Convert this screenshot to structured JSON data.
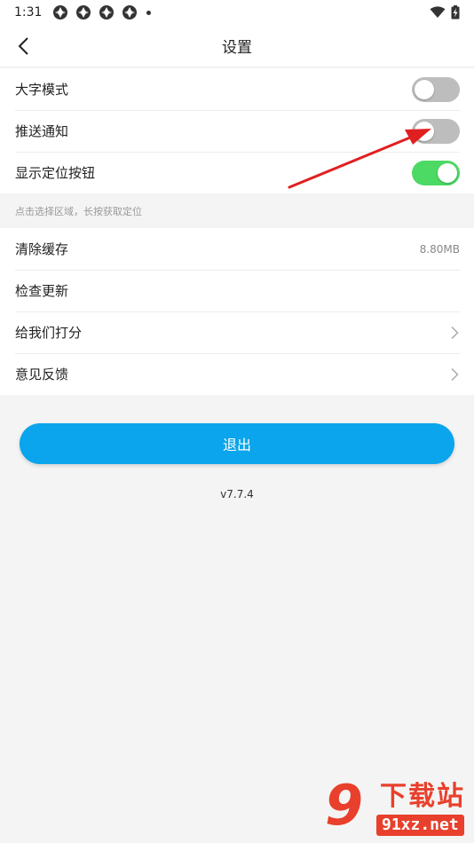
{
  "status_bar": {
    "time": "1:31",
    "notification_icons": [
      "app-notification-icon",
      "app-notification-icon",
      "app-notification-icon",
      "app-notification-icon"
    ],
    "wifi_icon": "wifi-icon",
    "battery_icon": "battery-charging-icon"
  },
  "header": {
    "title": "设置",
    "back_icon": "chevron-left-icon"
  },
  "toggles": [
    {
      "label": "大字模式",
      "on": false
    },
    {
      "label": "推送通知",
      "on": false
    },
    {
      "label": "显示定位按钮",
      "on": true
    }
  ],
  "hint": "点击选择区域，长按获取定位",
  "items": {
    "clear_cache": {
      "label": "清除缓存",
      "value": "8.80MB"
    },
    "check_update": {
      "label": "检查更新"
    },
    "rate_us": {
      "label": "给我们打分"
    },
    "feedback": {
      "label": "意见反馈"
    }
  },
  "logout_label": "退出",
  "version": "v7.7.4",
  "colors": {
    "accent": "#0aa5ec",
    "toggle_on": "#4cd964",
    "toggle_off": "#bdbdbd",
    "annotation_arrow": "#e02020",
    "watermark": "#e8402c"
  },
  "watermark": {
    "mark": "9",
    "title": "下载站",
    "site": "91xz.net"
  }
}
